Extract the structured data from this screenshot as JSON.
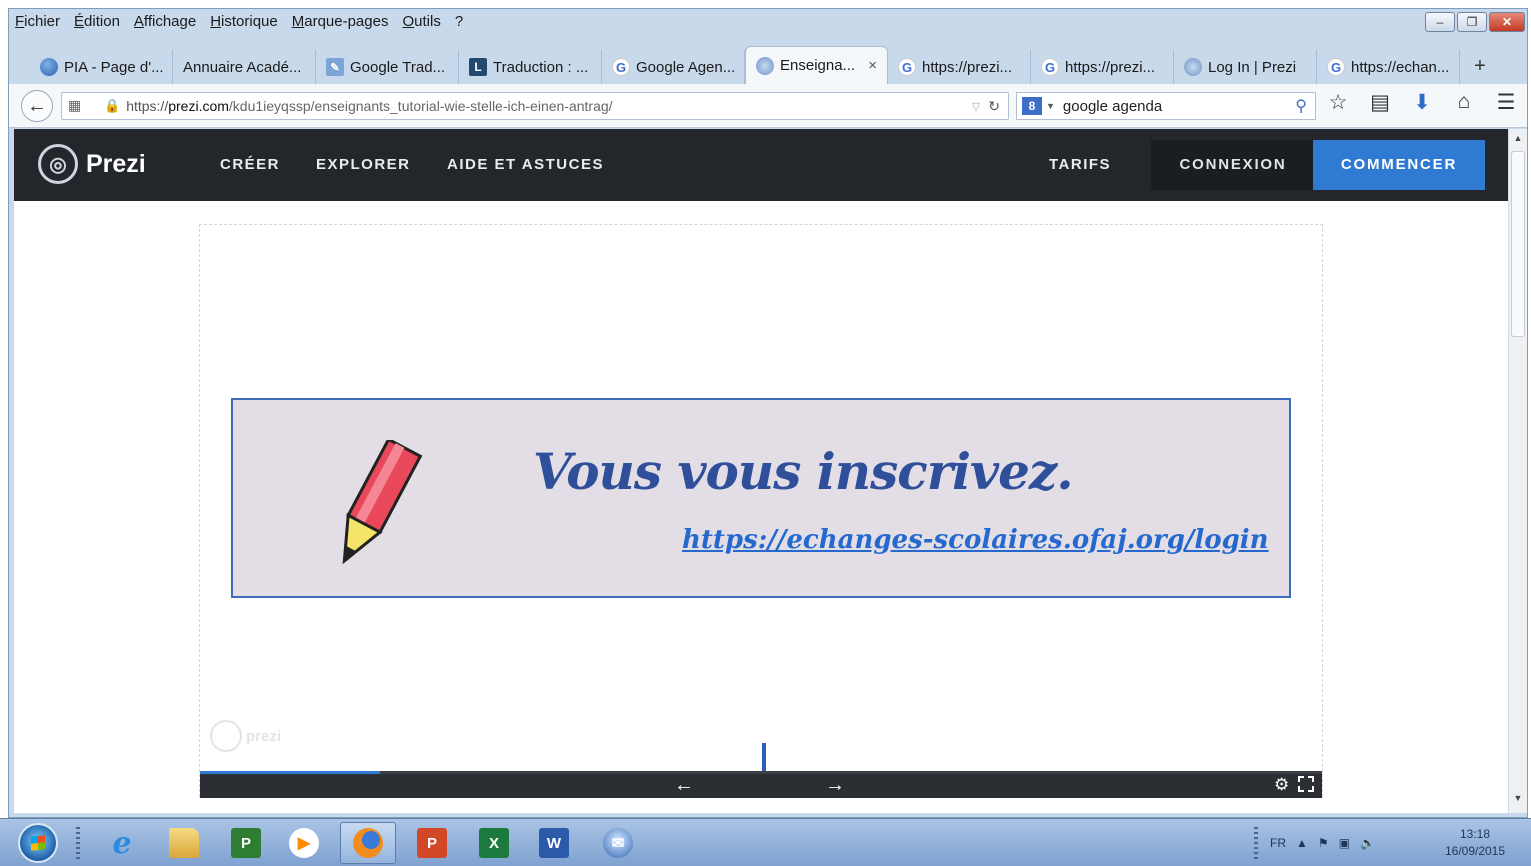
{
  "menu": [
    "Fichier",
    "Édition",
    "Affichage",
    "Historique",
    "Marque-pages",
    "Outils",
    "?"
  ],
  "window_controls": {
    "minimize": "–",
    "restore": "❐",
    "close": "✕"
  },
  "tabs": [
    {
      "label": "PIA - Page d'...",
      "icon": "globe-icon"
    },
    {
      "label": "Annuaire Acadé...",
      "icon": "none"
    },
    {
      "label": "Google Trad...",
      "icon": "doc-icon"
    },
    {
      "label": "Traduction : ...",
      "icon": "l-icon"
    },
    {
      "label": "Google Agen...",
      "icon": "google-icon"
    },
    {
      "label": "Enseigna...",
      "icon": "prezi-icon",
      "active": true
    },
    {
      "label": "https://prezi...",
      "icon": "google-icon"
    },
    {
      "label": "https://prezi...",
      "icon": "google-icon"
    },
    {
      "label": "Log In | Prezi",
      "icon": "prezi-icon"
    },
    {
      "label": "https://echan...",
      "icon": "google-icon"
    }
  ],
  "tab_close": "×",
  "new_tab": "+",
  "address": {
    "prefix": "https://",
    "domain": "prezi.com",
    "path": "/kdu1ieyqssp/enseignants_tutorial-wie-stelle-ich-einen-antrag/"
  },
  "search": {
    "engine_letter": "8",
    "value": "google agenda"
  },
  "prezi_nav": {
    "logo": "Prezi",
    "links": [
      "CRÉER",
      "EXPLORER",
      "AIDE ET ASTUCES"
    ],
    "tarifs": "TARIFS",
    "connexion": "CONNEXION",
    "commencer": "COMMENCER"
  },
  "slide": {
    "title": "Vous vous inscrivez.",
    "link": "https://echanges-scolaires.ofaj.org/login"
  },
  "watermark": "prezi",
  "player": {
    "progress": 0.16,
    "prev": "←",
    "next": "→"
  },
  "tray": {
    "lang": "FR",
    "time": "13:18",
    "date": "16/09/2015"
  },
  "colors": {
    "prezi_blue": "#2f7bd3",
    "nav_dark": "#23272c",
    "slide_bg": "#e3dee6",
    "slide_title": "#2f4f9a"
  }
}
